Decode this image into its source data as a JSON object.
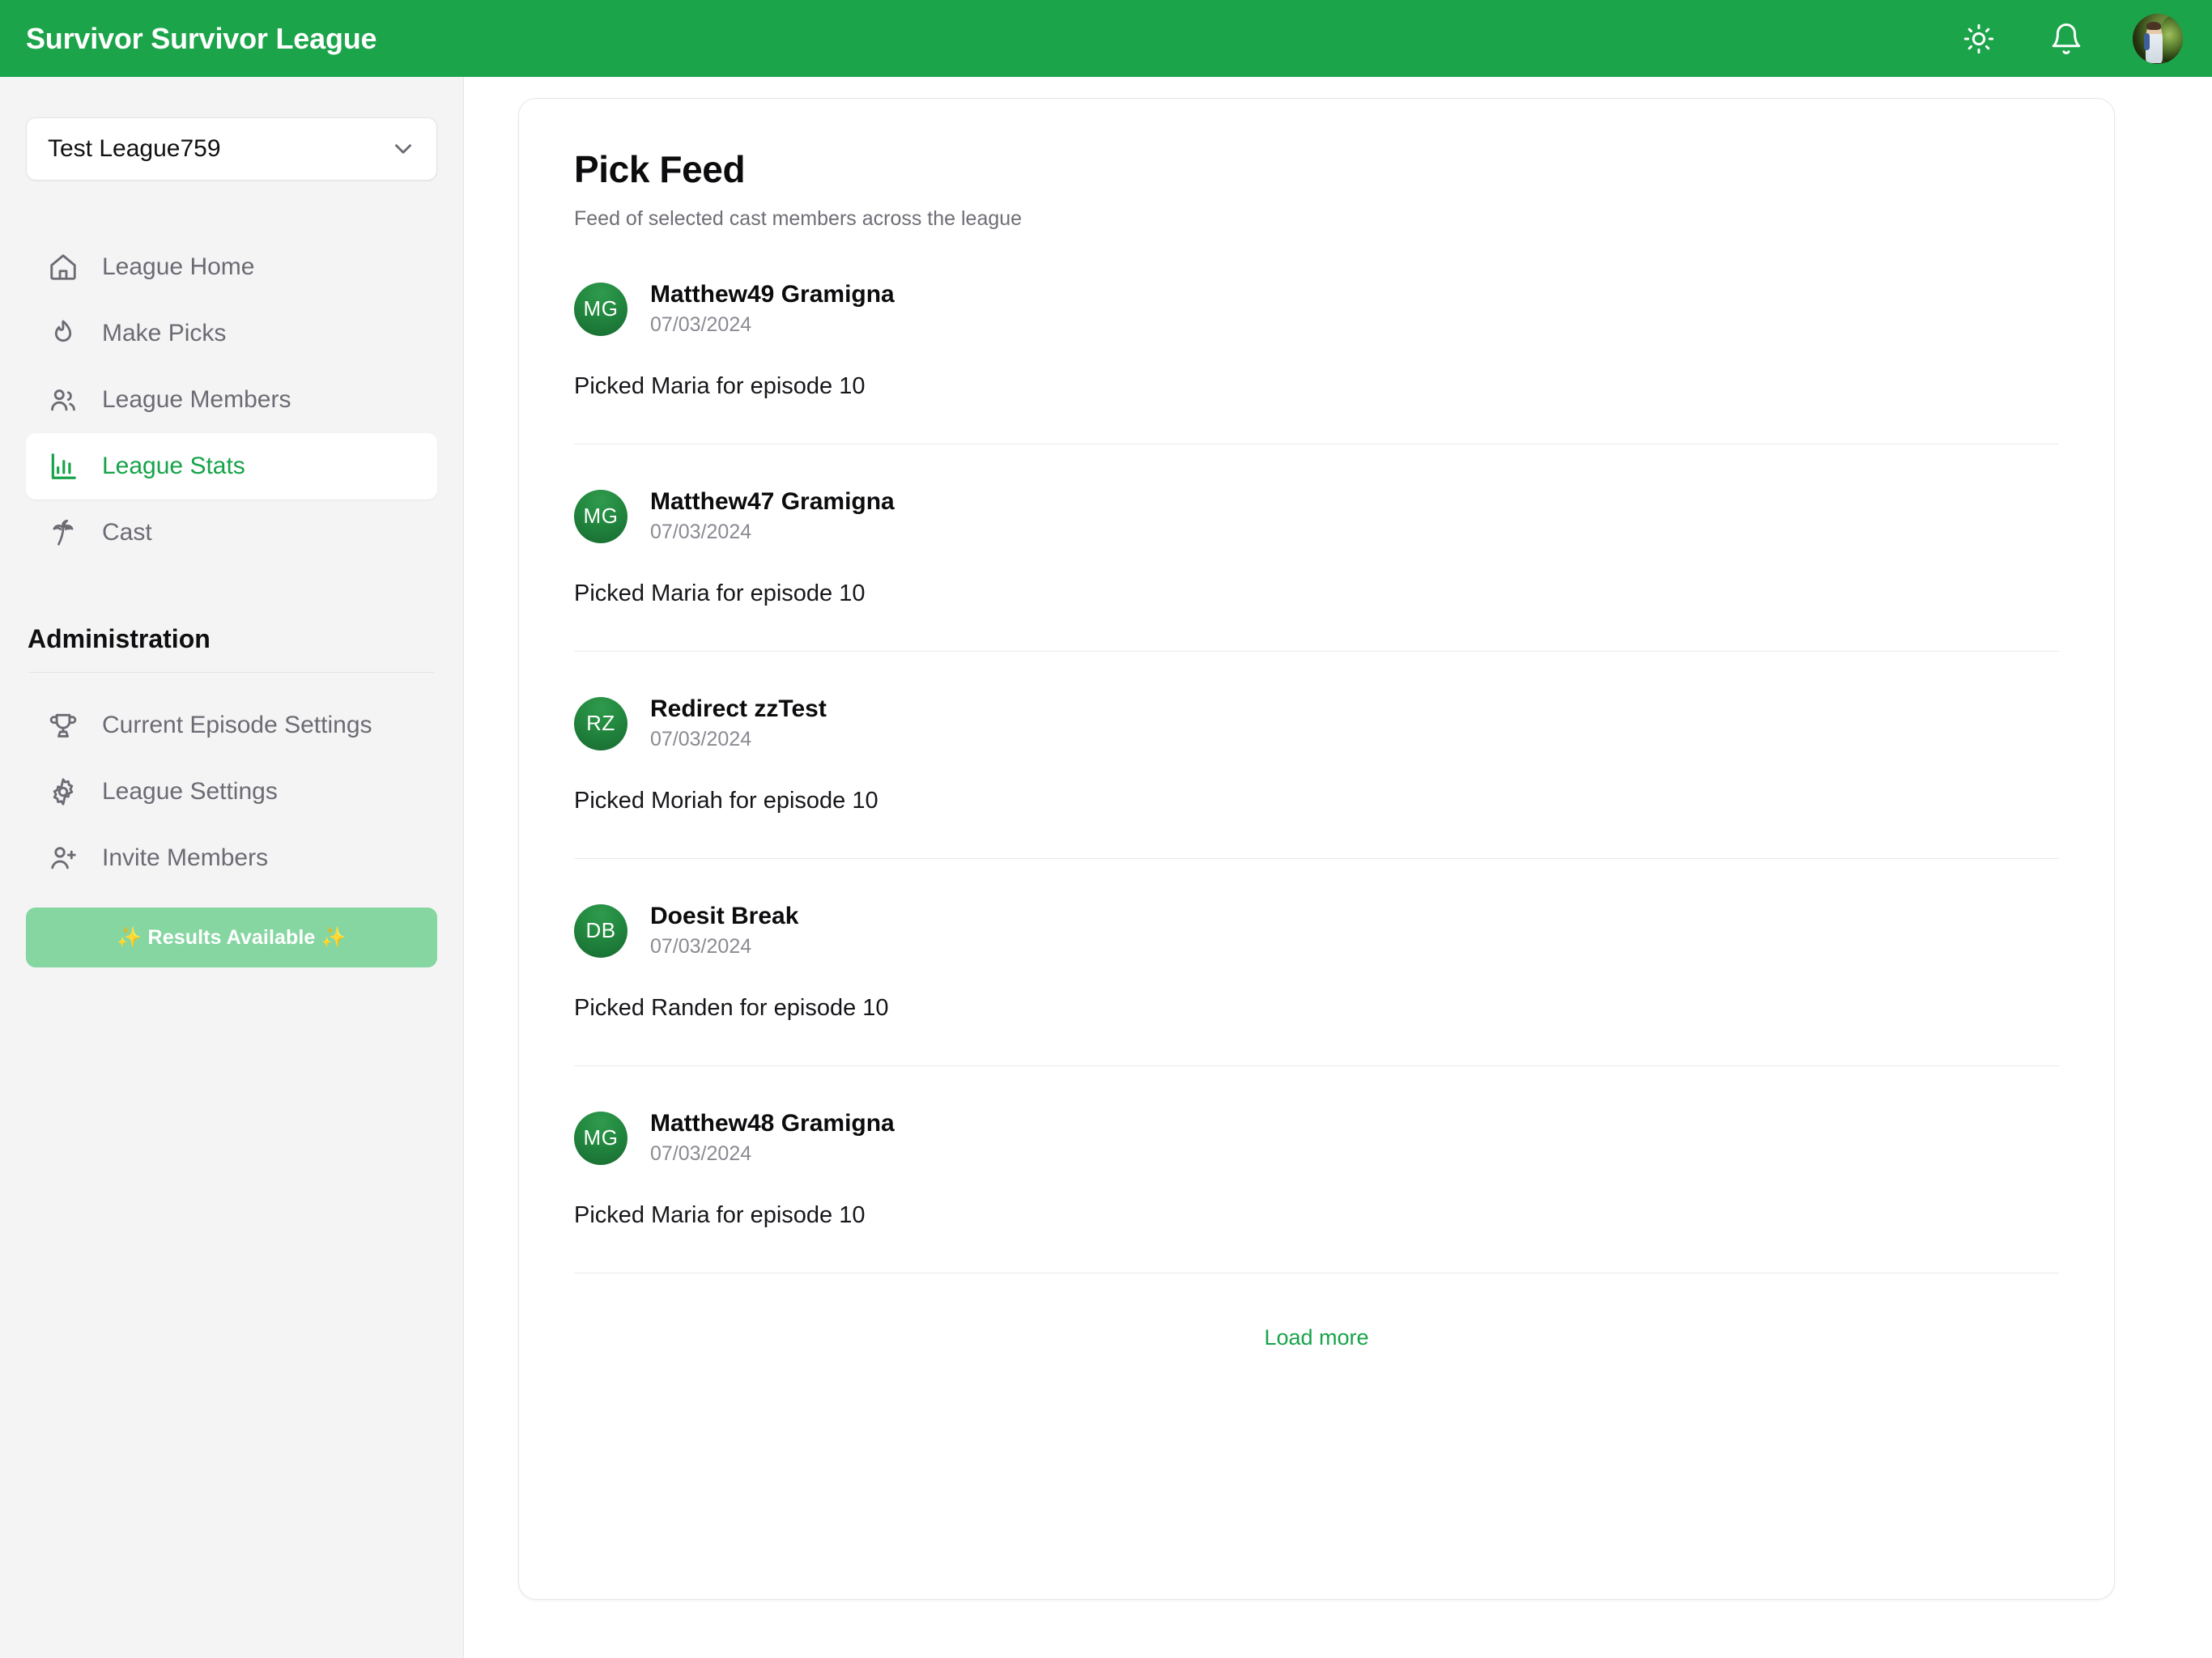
{
  "header": {
    "brand": "Survivor Survivor League",
    "theme_toggle_icon": "sun-icon",
    "notifications_icon": "bell-icon",
    "avatar_icon": "user-avatar"
  },
  "sidebar": {
    "league_selector": {
      "value": "Test League759",
      "chevron_icon": "chevron-down-icon"
    },
    "nav": [
      {
        "label": "League Home",
        "icon": "home-icon",
        "active": false
      },
      {
        "label": "Make Picks",
        "icon": "flame-icon",
        "active": false
      },
      {
        "label": "League Members",
        "icon": "users-icon",
        "active": false
      },
      {
        "label": "League Stats",
        "icon": "chart-bar-icon",
        "active": true
      },
      {
        "label": "Cast",
        "icon": "palm-tree-icon",
        "active": false
      }
    ],
    "administration": {
      "title": "Administration",
      "items": [
        {
          "label": "Current Episode Settings",
          "icon": "trophy-icon"
        },
        {
          "label": "League Settings",
          "icon": "gear-icon"
        },
        {
          "label": "Invite Members",
          "icon": "user-plus-icon"
        }
      ],
      "results_button": "✨ Results Available ✨"
    }
  },
  "main": {
    "title": "Pick Feed",
    "subtitle": "Feed of selected cast members across the league",
    "feed": [
      {
        "initials": "MG",
        "name": "Matthew49 Gramigna",
        "date": "07/03/2024",
        "text": "Picked Maria for episode 10"
      },
      {
        "initials": "MG",
        "name": "Matthew47 Gramigna",
        "date": "07/03/2024",
        "text": "Picked Maria for episode 10"
      },
      {
        "initials": "RZ",
        "name": "Redirect zzTest",
        "date": "07/03/2024",
        "text": "Picked Moriah for episode 10"
      },
      {
        "initials": "DB",
        "name": "Doesit Break",
        "date": "07/03/2024",
        "text": "Picked Randen for episode 10"
      },
      {
        "initials": "MG",
        "name": "Matthew48 Gramigna",
        "date": "07/03/2024",
        "text": "Picked Maria for episode 10"
      }
    ],
    "load_more_label": "Load more"
  },
  "colors": {
    "brand_green": "#1CA44A",
    "accent_green": "#16a34a",
    "results_button_green": "#86d6a2",
    "sidebar_bg": "#f4f4f5"
  }
}
